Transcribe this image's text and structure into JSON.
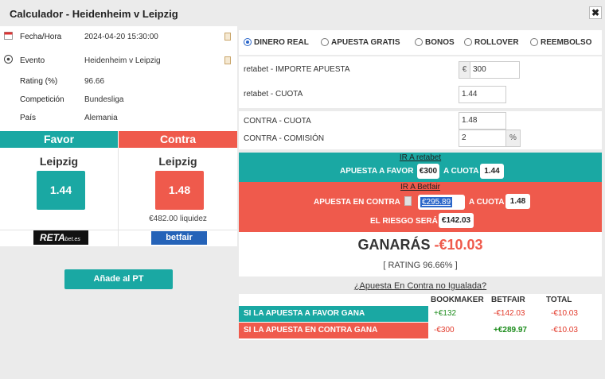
{
  "title": "Calculador - Heidenheim v Leipzig",
  "close_label": "✖",
  "info": {
    "fecha_label": "Fecha/Hora",
    "fecha_value": "2024-04-20 15:30:00",
    "evento_label": "Evento",
    "evento_value": "Heidenheim v Leipzig",
    "rating_label": "Rating (%)",
    "rating_value": "96.66",
    "competicion_label": "Competición",
    "competicion_value": "Bundesliga",
    "pais_label": "País",
    "pais_value": "Alemania"
  },
  "favor": {
    "header": "Favor",
    "team": "Leipzig",
    "odds": "1.44"
  },
  "contra": {
    "header": "Contra",
    "team": "Leipzig",
    "odds": "1.48",
    "liquidez": "€482.00 liquidez"
  },
  "logos": {
    "reta": "RETA",
    "reta_sub": "bet.es",
    "betfair": "betfair"
  },
  "add_button": "Añade al PT",
  "radios": [
    {
      "label": "DINERO REAL",
      "selected": true
    },
    {
      "label": "APUESTA GRATIS",
      "selected": false
    },
    {
      "label": "BONOS",
      "selected": false
    },
    {
      "label": "ROLLOVER",
      "selected": false
    },
    {
      "label": "REEMBOLSO",
      "selected": false
    }
  ],
  "form": {
    "importe_label": "retabet - IMPORTE APUESTA",
    "currency": "€",
    "importe_value": "300",
    "cuota_label": "retabet - CUOTA",
    "cuota_value": "1.44",
    "contra_cuota_label": "CONTRA - CUOTA",
    "contra_cuota_value": "1.48",
    "comision_label": "CONTRA - COMISIÓN",
    "comision_value": "2",
    "percent": "%"
  },
  "teal": {
    "link": "IR A retabet",
    "apuesta_label": "APUESTA A FAVOR",
    "apuesta_value": "€300",
    "cuota_label": "A CUOTA",
    "cuota_value": "1.44"
  },
  "red": {
    "link": "IR A Betfair",
    "apuesta_label": "APUESTA EN CONTRA",
    "apuesta_value": "€295.89",
    "cuota_label": "A CUOTA",
    "cuota_value": "1.48",
    "riesgo_label": "EL RIESGO SERÁ",
    "riesgo_value": "€142.03"
  },
  "result": {
    "ganaras_label": "GANARÁS",
    "ganaras_value": "-€10.03",
    "rating_text": "[ RATING 96.66% ]"
  },
  "no_igualada": "¿Apuesta En Contra no Igualada?",
  "table": {
    "headers": [
      "BOOKMAKER",
      "BETFAIR",
      "TOTAL"
    ],
    "rows": [
      {
        "label": "SI LA APUESTA A FAVOR GANA",
        "bookmaker": "+€132",
        "betfair": "-€142.03",
        "total": "-€10.03"
      },
      {
        "label": "SI LA APUESTA EN CONTRA GANA",
        "bookmaker": "-€300",
        "betfair": "+€289.97",
        "total": "-€10.03"
      }
    ]
  },
  "colors": {
    "teal": "#1aa8a3",
    "red": "#ef5a4c",
    "blue": "#2b66c9"
  }
}
